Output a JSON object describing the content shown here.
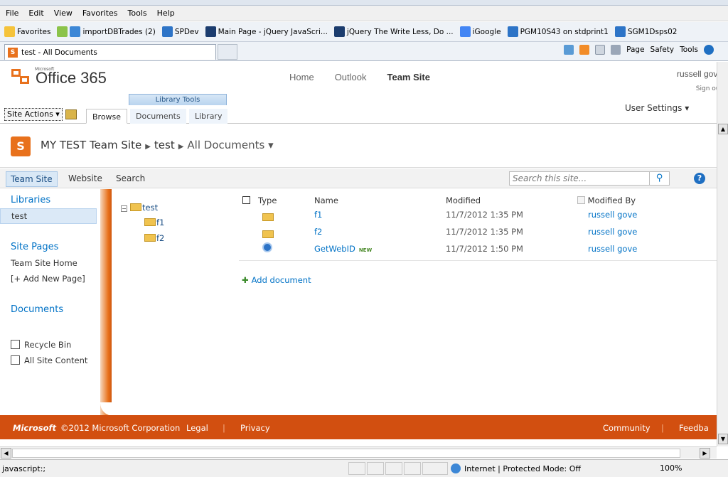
{
  "browser": {
    "menu": [
      "File",
      "Edit",
      "View",
      "Favorites",
      "Tools",
      "Help"
    ],
    "favorites_label": "Favorites",
    "favorites": [
      {
        "label": "importDBTrades (2)",
        "color": "#3c87d6"
      },
      {
        "label": "SPDev",
        "color": "#2d74c7"
      },
      {
        "label": "Main Page - jQuery JavaScri...",
        "color": "#1b3c6e"
      },
      {
        "label": "jQuery The Write Less, Do ...",
        "color": "#1b3c6e"
      },
      {
        "label": "iGoogle",
        "color": "#4285f4"
      },
      {
        "label": "PGM10S43 on stdprint1",
        "color": "#2d74c7"
      },
      {
        "label": "SGM1Dsps02",
        "color": "#2d74c7"
      }
    ],
    "tab_title": "test - All Documents",
    "commands": {
      "page": "Page",
      "safety": "Safety",
      "tools": "Tools"
    },
    "status_text": "javascript:;",
    "zone": "Internet | Protected Mode: Off",
    "zoom": "100%"
  },
  "header": {
    "ms_label": "Microsoft",
    "logo_text": "Office 365",
    "nav": [
      "Home",
      "Outlook",
      "Team Site"
    ],
    "user": "russell gove",
    "sign_out": "Sign out",
    "user_settings": "User Settings ▾"
  },
  "ribbon": {
    "site_actions": "Site Actions ▾",
    "library_tools": "Library Tools",
    "tabs": [
      "Browse",
      "Documents",
      "Library"
    ]
  },
  "title": {
    "site": "MY TEST Team Site",
    "list": "test",
    "view": "All Documents ▾"
  },
  "linkbar": {
    "links": [
      "Team Site",
      "Website",
      "Search"
    ],
    "search_placeholder": "Search this site..."
  },
  "leftnav": {
    "libraries": "Libraries",
    "library_item": "test",
    "site_pages": "Site Pages",
    "team_site_home": "Team Site Home",
    "add_new_page": "[+ Add New Page]",
    "documents": "Documents",
    "recycle_bin": "Recycle Bin",
    "all_site_content": "All Site Content"
  },
  "tree": {
    "root": "test",
    "children": [
      "f1",
      "f2"
    ]
  },
  "table": {
    "headers": {
      "type": "Type",
      "name": "Name",
      "modified": "Modified",
      "modified_by": "Modified By"
    },
    "rows": [
      {
        "name": "f1",
        "modified": "11/7/2012 1:35 PM",
        "by": "russell gove",
        "icon": "folder-icon"
      },
      {
        "name": "f2",
        "modified": "11/7/2012 1:35 PM",
        "by": "russell gove",
        "icon": "folder-icon"
      },
      {
        "name": "GetWebID",
        "modified": "11/7/2012 1:50 PM",
        "by": "russell gove",
        "icon": "ie-page-icon",
        "badge": "NEW"
      }
    ],
    "add_document": "Add document"
  },
  "footer": {
    "brand": "Microsoft",
    "copyright": "©2012 Microsoft Corporation",
    "legal": "Legal",
    "privacy": "Privacy",
    "community": "Community",
    "feedback": "Feedba"
  },
  "colors": {
    "accent_orange": "#d24f10",
    "link_blue": "#0072c6"
  }
}
